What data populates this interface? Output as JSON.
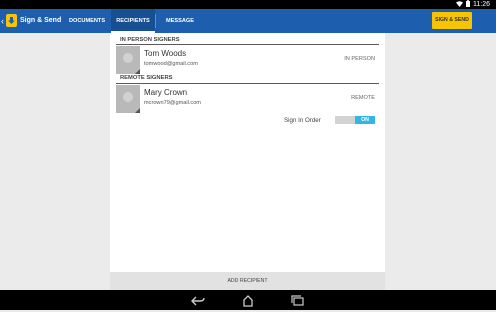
{
  "status_bar": {
    "time": "11:26"
  },
  "app_bar": {
    "title": "Sign & Send",
    "tabs": [
      {
        "label": "DOCUMENTS",
        "active": false
      },
      {
        "label": "RECIPIENTS",
        "active": true
      },
      {
        "label": "MESSAGE",
        "active": false
      }
    ],
    "action_label": "SIGN & SEND"
  },
  "sections": [
    {
      "header": "IN PERSON SIGNERS",
      "signers": [
        {
          "name": "Tom Woods",
          "email": "tomwood@gmail.com",
          "type": "IN PERSON"
        }
      ]
    },
    {
      "header": "REMOTE SIGNERS",
      "signers": [
        {
          "name": "Mary Crown",
          "email": "mcrown79@gmail.com",
          "type": "REMOTE"
        }
      ]
    }
  ],
  "sign_in_order": {
    "label": "Sign In Order",
    "state": "ON"
  },
  "add_recipient_label": "ADD RECIPIENT",
  "colors": {
    "app_bar": "#1d5fae",
    "accent": "#f6c400",
    "toggle_on": "#33b5e5"
  },
  "icons": [
    "wifi-icon",
    "battery-icon",
    "back-chevron-icon",
    "app-logo-icon",
    "back-icon",
    "home-icon",
    "recents-icon"
  ]
}
